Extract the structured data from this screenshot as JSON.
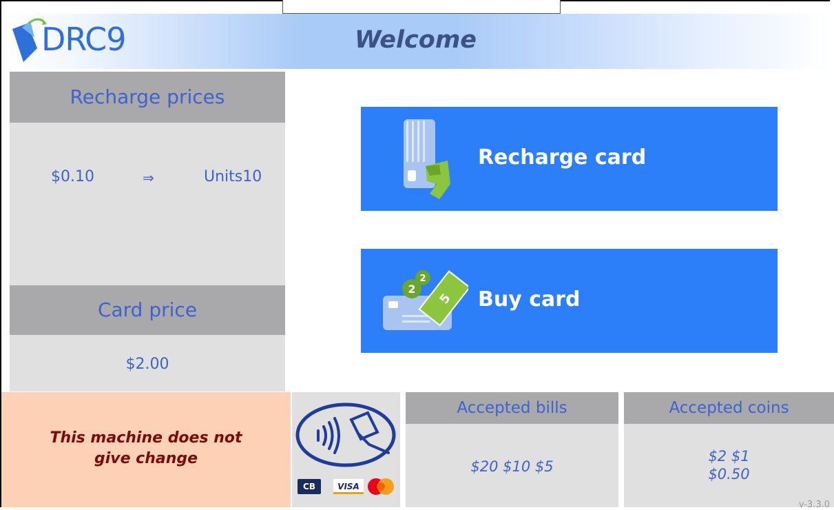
{
  "header": {
    "logo_text": "DRC9",
    "title": "Welcome"
  },
  "recharge_prices": {
    "title": "Recharge prices",
    "rows": [
      {
        "amount": "$0.10",
        "arrow": "⇒",
        "units": "Units10"
      }
    ]
  },
  "card_price": {
    "title": "Card price",
    "value": "$2.00"
  },
  "actions": {
    "recharge_label": "Recharge card",
    "buy_label": "Buy card"
  },
  "notice": {
    "line1": "This machine does not",
    "line2": "give change"
  },
  "payment": {
    "contactless_icon": "contactless-card-icon",
    "card_brands": [
      "CB",
      "VISA",
      "MasterCard"
    ]
  },
  "bills": {
    "title": "Accepted bills",
    "values": "$20 $10 $5"
  },
  "coins": {
    "title": "Accepted coins",
    "line1": "$2 $1",
    "line2": "$0.50"
  },
  "version": "v-3.3.0",
  "colors": {
    "button_blue": "#2c7ff8",
    "panel_header": "#a9a9ab",
    "panel_body": "#e0e0e0",
    "notice_bg": "#fcd1b5",
    "notice_text": "#7a0b0b",
    "label_blue": "#3f62cc"
  }
}
